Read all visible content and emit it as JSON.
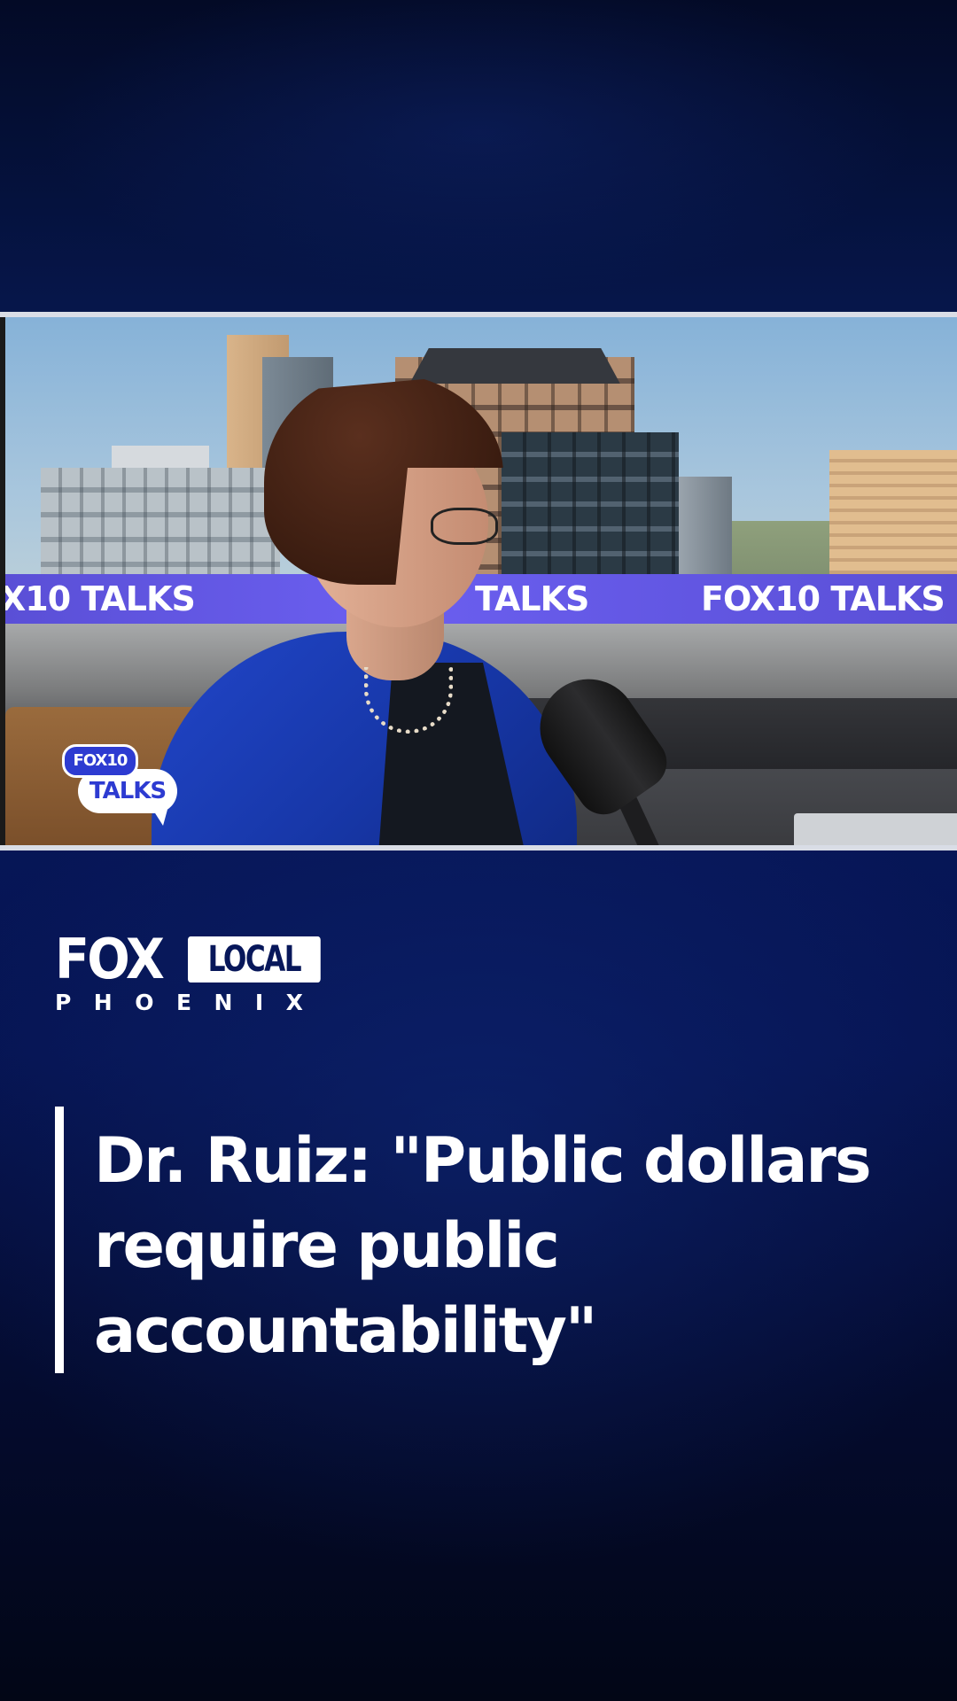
{
  "video": {
    "banner_texts": [
      "X10 TALKS",
      "TALKS",
      "FOX10 TALKS"
    ],
    "logo": {
      "top": "FOX10",
      "bubble": "TALKS"
    }
  },
  "brand": {
    "fox": "FOX",
    "local": "LOCAL",
    "city_letters": [
      "P",
      "H",
      "O",
      "E",
      "N",
      "I",
      "X"
    ]
  },
  "headline": {
    "text": "Dr. Ruiz: \"Public dollars require public accountability\""
  },
  "colors": {
    "background_top": "#030a26",
    "background_mid": "#07175a",
    "background_bottom": "#020616",
    "banner_purple": "#6b5ff0",
    "jacket_blue": "#2146c9",
    "text": "#ffffff"
  }
}
